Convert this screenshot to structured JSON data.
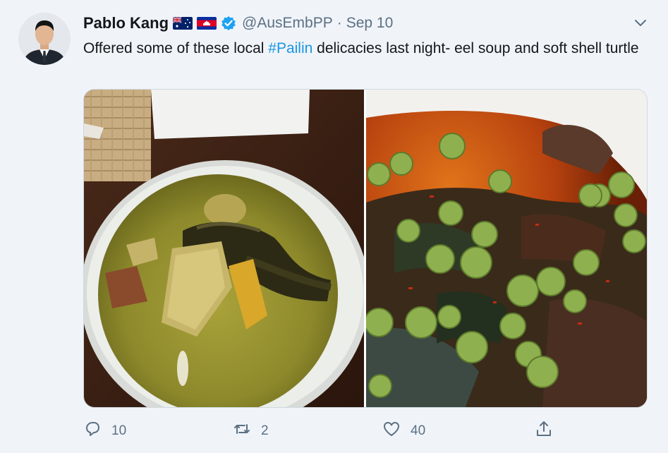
{
  "author": {
    "name": "Pablo Kang",
    "handle": "@AusEmbPP",
    "separator": "·",
    "date": "Sep 10",
    "flags": [
      "australia-flag-icon",
      "cambodia-flag-icon"
    ],
    "verified_icon": "verified-badge-icon"
  },
  "tweet": {
    "text_before": "Offered some of these local ",
    "hashtag": "#Pailin",
    "text_after": " delicacies last night- eel soup and soft shell turtle"
  },
  "media": {
    "photos": [
      "photo-eel-soup",
      "photo-soft-shell-turtle"
    ]
  },
  "actions": {
    "reply_count": "10",
    "retweet_count": "2",
    "like_count": "40"
  },
  "colors": {
    "link": "#1b95e0",
    "secondary_text": "#5b7083",
    "verified": "#1da1f2"
  }
}
